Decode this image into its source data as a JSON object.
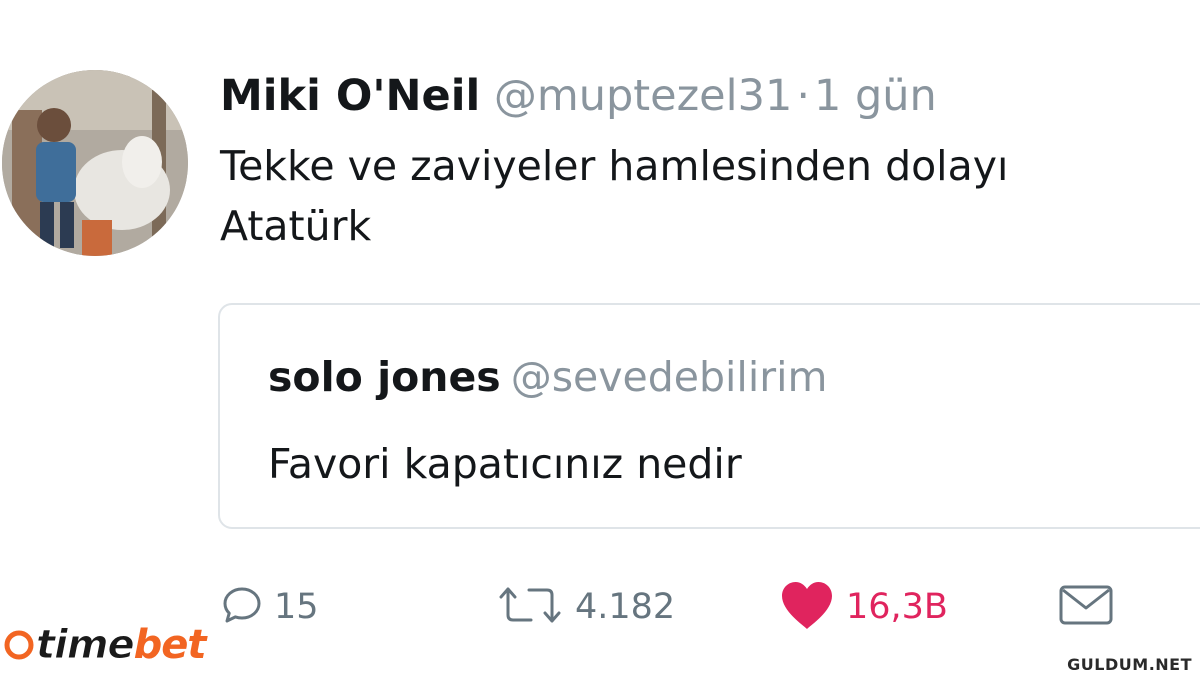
{
  "tweet": {
    "display_name": "Miki O'Neil",
    "handle": "@muptezel31",
    "separator": "·",
    "time": "1 gün",
    "text_lines": [
      "Tekke ve zaviyeler hamlesinden dolayı",
      "Atatürk"
    ]
  },
  "quoted": {
    "display_name": "solo jones",
    "handle": "@sevedebilirim",
    "text": "Favori kapatıcınız nedir"
  },
  "actions": {
    "reply": {
      "icon": "reply-icon",
      "count": "15"
    },
    "retweet": {
      "icon": "retweet-icon",
      "count": "4.182"
    },
    "like": {
      "icon": "heart-icon",
      "count": "16,3B",
      "color": "#e0245e"
    },
    "dm": {
      "icon": "envelope-icon"
    }
  },
  "watermarks": {
    "left": {
      "part1": "time",
      "part2": "bet",
      "accent": "#f26522"
    },
    "right": "GULDUM.NET"
  }
}
